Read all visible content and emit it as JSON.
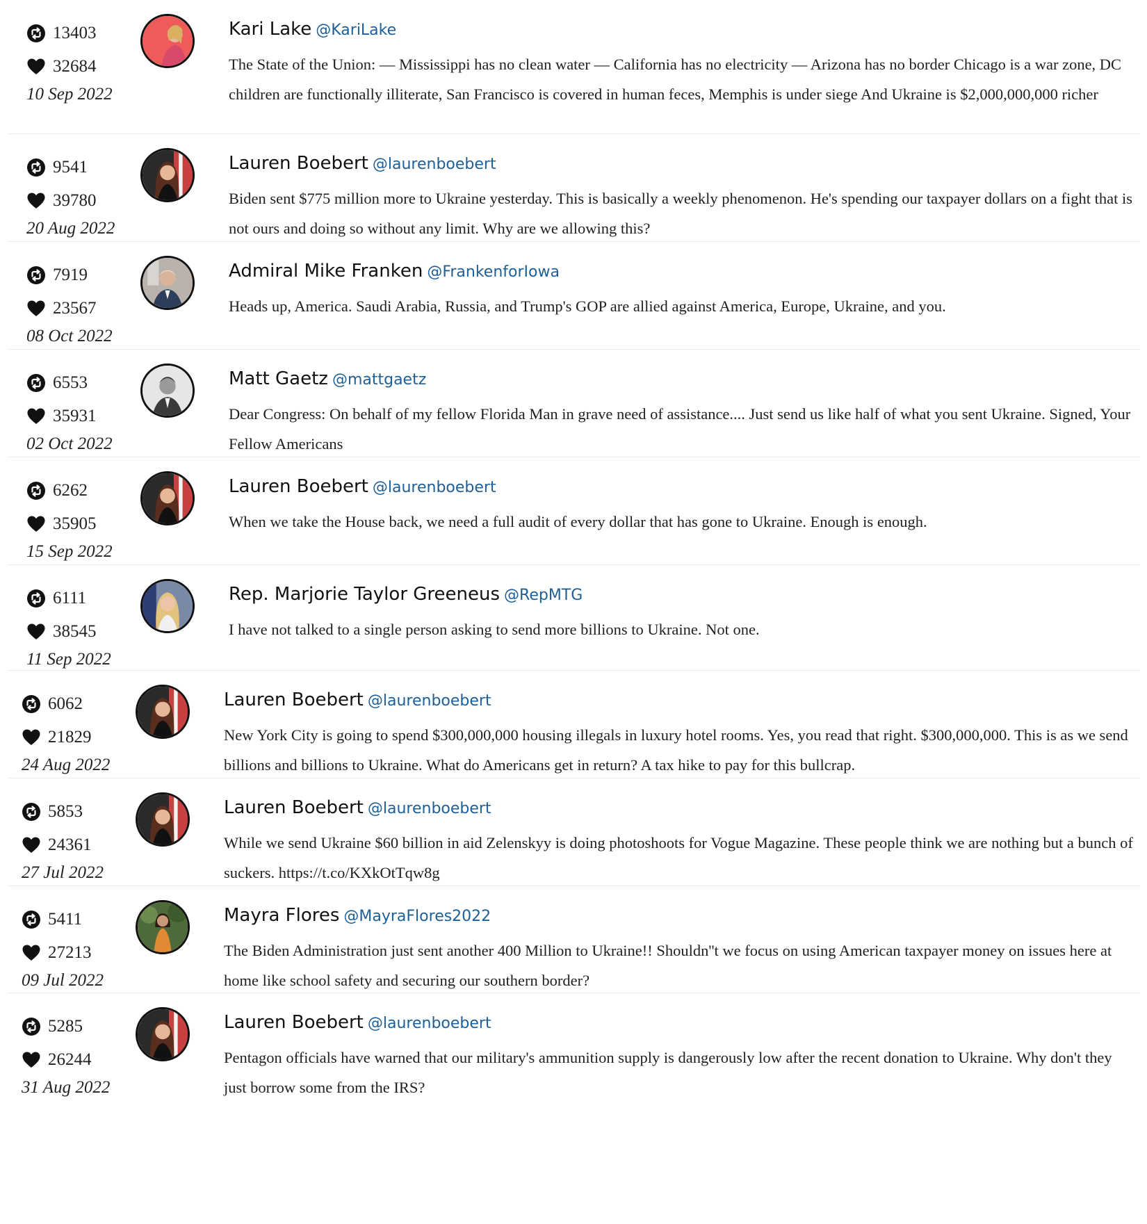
{
  "icons": {
    "retweet": "retweet-icon",
    "like": "heart-icon"
  },
  "colors": {
    "handle": "#1d5f96",
    "divider": "#ececec"
  },
  "tweets": [
    {
      "retweets": "13403",
      "likes": "32684",
      "date": "10 Sep 2022",
      "name": "Kari Lake",
      "handle": "@KariLake",
      "text": "The State of the Union: — Mississippi has no clean water — California has no electricity — Arizona has no border Chicago is a war zone, DC children are functionally illiterate, San Francisco is covered in human feces, Memphis is under siege And Ukraine is $2,000,000,000 richer"
    },
    {
      "retweets": "9541",
      "likes": "39780",
      "date": "20 Aug 2022",
      "name": "Lauren Boebert",
      "handle": "@laurenboebert",
      "text": "Biden sent $775 million more to Ukraine yesterday. This is basically a weekly phenomenon. He's spending our taxpayer dollars on a fight that is not ours and doing so without any limit. Why are we allowing this?"
    },
    {
      "retweets": "7919",
      "likes": "23567",
      "date": "08 Oct 2022",
      "name": "Admiral Mike Franken",
      "handle": "@FrankenforIowa",
      "text": "Heads up, America. Saudi Arabia, Russia, and Trump's GOP are allied against America, Europe, Ukraine, and you."
    },
    {
      "retweets": "6553",
      "likes": "35931",
      "date": "02 Oct 2022",
      "name": "Matt Gaetz",
      "handle": "@mattgaetz",
      "text": "Dear Congress: On behalf of my fellow Florida Man in grave need of assistance.... Just send us like half of what you sent Ukraine. Signed, Your Fellow Americans"
    },
    {
      "retweets": "6262",
      "likes": "35905",
      "date": "15 Sep 2022",
      "name": "Lauren Boebert",
      "handle": "@laurenboebert",
      "text": "When we take the House back, we need a full audit of every dollar that has gone to Ukraine. Enough is enough."
    },
    {
      "retweets": "6111",
      "likes": "38545",
      "date": "11 Sep 2022",
      "name": "Rep. Marjorie Taylor Greeneus",
      "handle": "@RepMTG",
      "text": "I have not talked to a single person asking to send more billions to Ukraine. Not one."
    },
    {
      "retweets": "6062",
      "likes": "21829",
      "date": "24 Aug 2022",
      "name": "Lauren Boebert",
      "handle": "@laurenboebert",
      "text": "New York City is going to spend $300,000,000 housing illegals in luxury hotel rooms. Yes, you read that right. $300,000,000. This is as we send billions and billions to Ukraine. What do Americans get in return? A tax hike to pay for this bullcrap."
    },
    {
      "retweets": "5853",
      "likes": "24361",
      "date": "27 Jul 2022",
      "name": "Lauren Boebert",
      "handle": "@laurenboebert",
      "text": "While we send Ukraine $60 billion in aid Zelenskyy is doing photoshoots for Vogue Magazine. These people think we are nothing but a bunch of suckers. https://t.co/KXkOtTqw8g"
    },
    {
      "retweets": "5411",
      "likes": "27213",
      "date": "09 Jul 2022",
      "name": "Mayra Flores",
      "handle": "@MayraFlores2022",
      "text": "The Biden Administration just sent another 400 Million to Ukraine!! Shouldn''t we focus on using American taxpayer money on issues here at home like school safety and securing our southern border?"
    },
    {
      "retweets": "5285",
      "likes": "26244",
      "date": "31 Aug 2022",
      "name": "Lauren Boebert",
      "handle": "@laurenboebert",
      "text": "Pentagon officials have warned that our military's ammunition supply is dangerously low after the recent donation to Ukraine. Why don't they just borrow some from the IRS?"
    }
  ]
}
